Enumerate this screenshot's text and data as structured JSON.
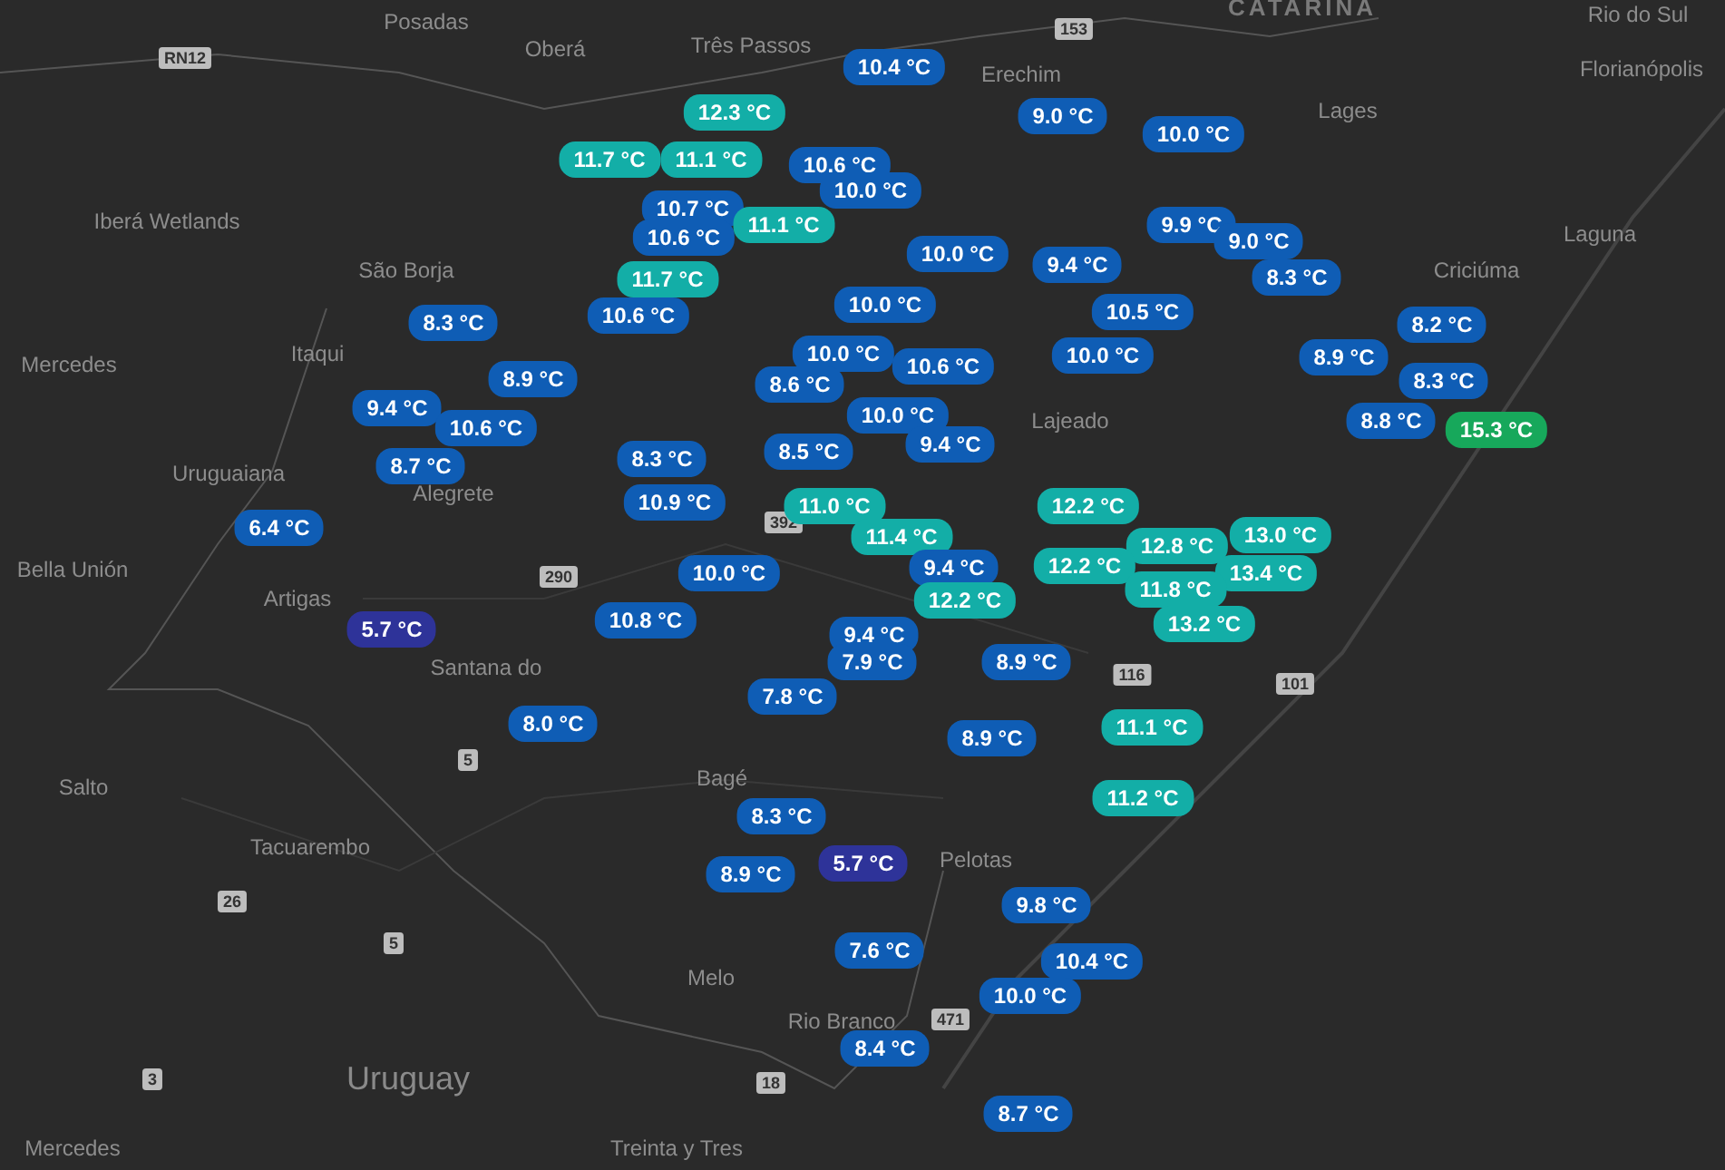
{
  "map": {
    "labels": [
      {
        "text": "Posadas",
        "kind": "city"
      },
      {
        "text": "Oberá",
        "kind": "city"
      },
      {
        "text": "Três Passos",
        "kind": "city"
      },
      {
        "text": "Erechim",
        "kind": "city"
      },
      {
        "text": "CATARINA",
        "kind": "region"
      },
      {
        "text": "Rio do Sul",
        "kind": "city"
      },
      {
        "text": "Florianópolis",
        "kind": "city"
      },
      {
        "text": "Lages",
        "kind": "city"
      },
      {
        "text": "Laguna",
        "kind": "city"
      },
      {
        "text": "Criciúma",
        "kind": "city"
      },
      {
        "text": "Iberá Wetlands",
        "kind": "city"
      },
      {
        "text": "São Borja",
        "kind": "city"
      },
      {
        "text": "Itaqui",
        "kind": "city"
      },
      {
        "text": "Mercedes",
        "kind": "city"
      },
      {
        "text": "Uruguaiana",
        "kind": "city"
      },
      {
        "text": "Alegrete",
        "kind": "city"
      },
      {
        "text": "Bella Unión",
        "kind": "city"
      },
      {
        "text": "Artigas",
        "kind": "city"
      },
      {
        "text": "Santana do",
        "kind": "city"
      },
      {
        "text": "Lajeado",
        "kind": "city"
      },
      {
        "text": "Bagé",
        "kind": "city"
      },
      {
        "text": "Salto",
        "kind": "city"
      },
      {
        "text": "Tacuarembo",
        "kind": "city"
      },
      {
        "text": "Pelotas",
        "kind": "city"
      },
      {
        "text": "Melo",
        "kind": "city"
      },
      {
        "text": "Rio Branco",
        "kind": "city"
      },
      {
        "text": "Uruguay",
        "kind": "country"
      },
      {
        "text": "Treinta y Tres",
        "kind": "city"
      },
      {
        "text": "Mercedes",
        "kind": "city"
      },
      {
        "text": "RN12",
        "kind": "shield"
      },
      {
        "text": "153",
        "kind": "shield"
      },
      {
        "text": "290",
        "kind": "shield"
      },
      {
        "text": "392",
        "kind": "shield"
      },
      {
        "text": "116",
        "kind": "shield"
      },
      {
        "text": "101",
        "kind": "shield"
      },
      {
        "text": "5",
        "kind": "shield"
      },
      {
        "text": "26",
        "kind": "shield"
      },
      {
        "text": "5",
        "kind": "shield"
      },
      {
        "text": "471",
        "kind": "shield"
      },
      {
        "text": "3",
        "kind": "shield"
      },
      {
        "text": "18",
        "kind": "shield"
      }
    ],
    "markers": [
      {
        "text": "10.4 °C",
        "color": "#0f5db5"
      },
      {
        "text": "12.3 °C",
        "color": "#13aea7"
      },
      {
        "text": "9.0 °C",
        "color": "#0f5db5"
      },
      {
        "text": "10.0 °C",
        "color": "#0f5db5"
      },
      {
        "text": "11.7 °C",
        "color": "#13aea7"
      },
      {
        "text": "11.1 °C",
        "color": "#13aea7"
      },
      {
        "text": "10.6 °C",
        "color": "#0f5db5"
      },
      {
        "text": "10.0 °C",
        "color": "#0f5db5"
      },
      {
        "text": "10.7 °C",
        "color": "#0f5db5"
      },
      {
        "text": "10.6 °C",
        "color": "#0f5db5"
      },
      {
        "text": "11.1 °C",
        "color": "#13aea7"
      },
      {
        "text": "9.9 °C",
        "color": "#0f5db5"
      },
      {
        "text": "9.0 °C",
        "color": "#0f5db5"
      },
      {
        "text": "10.0 °C",
        "color": "#0f5db5"
      },
      {
        "text": "9.4 °C",
        "color": "#0f5db5"
      },
      {
        "text": "11.7 °C",
        "color": "#13aea7"
      },
      {
        "text": "8.3 °C",
        "color": "#0f5db5"
      },
      {
        "text": "8.3 °C",
        "color": "#0f5db5"
      },
      {
        "text": "10.6 °C",
        "color": "#0f5db5"
      },
      {
        "text": "10.0 °C",
        "color": "#0f5db5"
      },
      {
        "text": "10.5 °C",
        "color": "#0f5db5"
      },
      {
        "text": "8.2 °C",
        "color": "#0f5db5"
      },
      {
        "text": "10.0 °C",
        "color": "#0f5db5"
      },
      {
        "text": "10.6 °C",
        "color": "#0f5db5"
      },
      {
        "text": "10.0 °C",
        "color": "#0f5db5"
      },
      {
        "text": "8.9 °C",
        "color": "#0f5db5"
      },
      {
        "text": "8.9 °C",
        "color": "#0f5db5"
      },
      {
        "text": "8.6 °C",
        "color": "#0f5db5"
      },
      {
        "text": "8.3 °C",
        "color": "#0f5db5"
      },
      {
        "text": "9.4 °C",
        "color": "#0f5db5"
      },
      {
        "text": "10.6 °C",
        "color": "#0f5db5"
      },
      {
        "text": "10.0 °C",
        "color": "#0f5db5"
      },
      {
        "text": "8.8 °C",
        "color": "#0f5db5"
      },
      {
        "text": "15.3 °C",
        "color": "#17a85b"
      },
      {
        "text": "8.7 °C",
        "color": "#0f5db5"
      },
      {
        "text": "8.3 °C",
        "color": "#0f5db5"
      },
      {
        "text": "8.5 °C",
        "color": "#0f5db5"
      },
      {
        "text": "9.4 °C",
        "color": "#0f5db5"
      },
      {
        "text": "10.9 °C",
        "color": "#0f5db5"
      },
      {
        "text": "11.0 °C",
        "color": "#13aea7"
      },
      {
        "text": "12.2 °C",
        "color": "#13aea7"
      },
      {
        "text": "6.4 °C",
        "color": "#0f5db5"
      },
      {
        "text": "11.4 °C",
        "color": "#13aea7"
      },
      {
        "text": "12.8 °C",
        "color": "#13aea7"
      },
      {
        "text": "13.0 °C",
        "color": "#13aea7"
      },
      {
        "text": "10.0 °C",
        "color": "#0f5db5"
      },
      {
        "text": "9.4 °C",
        "color": "#0f5db5"
      },
      {
        "text": "12.2 °C",
        "color": "#13aea7"
      },
      {
        "text": "13.4 °C",
        "color": "#13aea7"
      },
      {
        "text": "12.2 °C",
        "color": "#13aea7"
      },
      {
        "text": "11.8 °C",
        "color": "#13aea7"
      },
      {
        "text": "5.7 °C",
        "color": "#2e3399"
      },
      {
        "text": "10.8 °C",
        "color": "#0f5db5"
      },
      {
        "text": "9.4 °C",
        "color": "#0f5db5"
      },
      {
        "text": "13.2 °C",
        "color": "#13aea7"
      },
      {
        "text": "7.9 °C",
        "color": "#0f5db5"
      },
      {
        "text": "8.9 °C",
        "color": "#0f5db5"
      },
      {
        "text": "7.8 °C",
        "color": "#0f5db5"
      },
      {
        "text": "8.0 °C",
        "color": "#0f5db5"
      },
      {
        "text": "8.9 °C",
        "color": "#0f5db5"
      },
      {
        "text": "11.1 °C",
        "color": "#13aea7"
      },
      {
        "text": "8.3 °C",
        "color": "#0f5db5"
      },
      {
        "text": "11.2 °C",
        "color": "#13aea7"
      },
      {
        "text": "8.9 °C",
        "color": "#0f5db5"
      },
      {
        "text": "5.7 °C",
        "color": "#2e3399"
      },
      {
        "text": "9.8 °C",
        "color": "#0f5db5"
      },
      {
        "text": "7.6 °C",
        "color": "#0f5db5"
      },
      {
        "text": "10.4 °C",
        "color": "#0f5db5"
      },
      {
        "text": "10.0 °C",
        "color": "#0f5db5"
      },
      {
        "text": "8.4 °C",
        "color": "#0f5db5"
      },
      {
        "text": "8.7 °C",
        "color": "#0f5db5"
      }
    ]
  }
}
